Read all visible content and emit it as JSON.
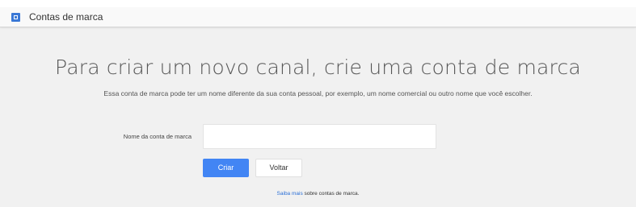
{
  "header": {
    "icon": "brand-account-icon",
    "title": "Contas de marca"
  },
  "main": {
    "title": "Para criar um novo canal, crie uma conta de marca",
    "subtitle": "Essa conta de marca pode ter um nome diferente da sua conta pessoal, por exemplo, um nome comercial ou outro nome que você escolher."
  },
  "form": {
    "name_label": "Nome da conta de marca",
    "name_value": "",
    "name_placeholder": "",
    "create_label": "Criar",
    "back_label": "Voltar"
  },
  "footer": {
    "link_text": "Saiba mais",
    "rest_text": " sobre contas de marca."
  },
  "colors": {
    "accent": "#4285f4",
    "link": "#2a6fd6",
    "background": "#f1f1f1"
  }
}
